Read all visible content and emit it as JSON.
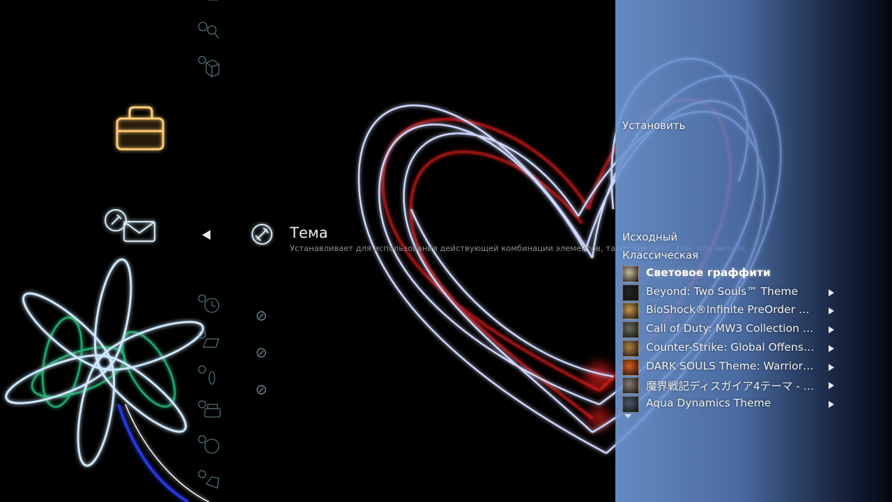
{
  "setting": {
    "title": "Тема",
    "description": "Устанавливает для использования действующей комбинации элементов, таких как цвет, фон, или иконки."
  },
  "panel": {
    "install_label": "Установить",
    "items": [
      {
        "label": "Исходный"
      },
      {
        "label": "Классическая"
      }
    ],
    "themes": [
      {
        "label": "Световое граффити",
        "thumb": "light-graffiti",
        "color": "#c8b89a",
        "selected": true,
        "has_arrow": false
      },
      {
        "label": "Beyond: Two Souls™ Theme",
        "thumb": "beyond",
        "color": "#222222",
        "selected": false,
        "has_arrow": true
      },
      {
        "label": "BioShock®Infinite PreOrder D…",
        "thumb": "bioshock",
        "color": "#c99a4a",
        "selected": false,
        "has_arrow": true
      },
      {
        "label": "Call of Duty: MW3 Collection …",
        "thumb": "call-of-duty",
        "color": "#6a6a5a",
        "selected": false,
        "has_arrow": true
      },
      {
        "label": "Counter-Strike: Global Offens…",
        "thumb": "counter-strike",
        "color": "#b08040",
        "selected": false,
        "has_arrow": true
      },
      {
        "label": "DARK SOULS Theme: Warrior…",
        "thumb": "dark-souls",
        "color": "#d85a1a",
        "selected": false,
        "has_arrow": true
      },
      {
        "label": "魔界戦記ディスガイア4テーマ - …",
        "thumb": "disgaea",
        "color": "#8a7a70",
        "selected": false,
        "has_arrow": true
      },
      {
        "label": "Aqua Dynamics Theme",
        "thumb": "aqua-dynamics",
        "color": "#4a5a6a",
        "selected": false,
        "has_arrow": true
      }
    ]
  },
  "icons": {
    "category": "settings-category-icon",
    "theme": "theme-settings-icon",
    "back": "arrow-left-icon"
  }
}
